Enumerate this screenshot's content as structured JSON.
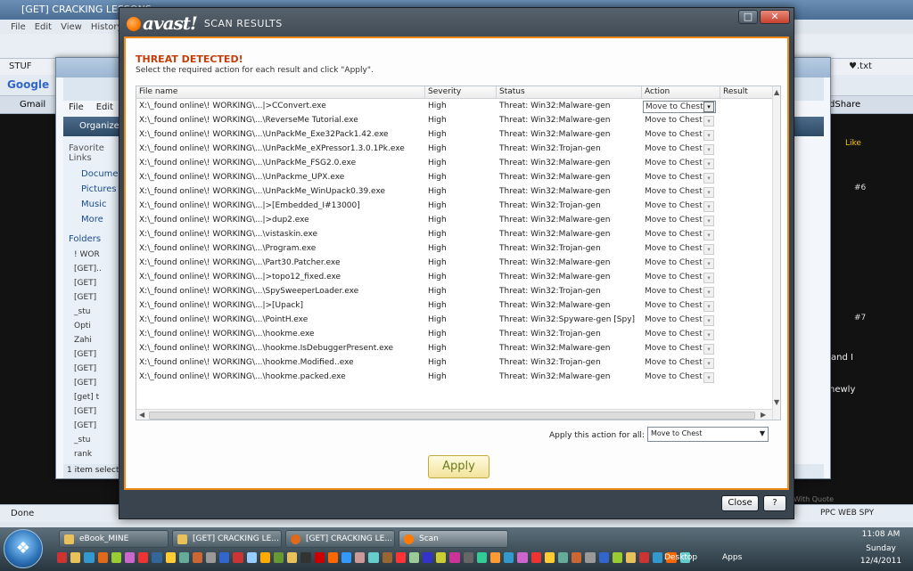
{
  "browser": {
    "title": "[GET] CRACKING LESSONS",
    "menu": [
      "File",
      "Edit",
      "View",
      "History"
    ],
    "bookmark": "STUF",
    "google": "Google",
    "gmail": "Gmail",
    "status": "Done",
    "forum": {
      "like": "Like",
      "post6": "#6",
      "post7": "#7",
      "snippet1": "and I",
      "snippet2": "newly",
      "ppc": "PPC WEB SPY",
      "share": "dShare",
      "txt": "♥.txt",
      "with_quote": "With Quote"
    }
  },
  "explorer": {
    "menu": [
      "File",
      "Edit"
    ],
    "organize": "Organize",
    "favorite_links": "Favorite Links",
    "links": [
      "Documen",
      "Pictures",
      "Music",
      "More"
    ],
    "folders_label": "Folders",
    "folders": [
      "!  WOR",
      "[GET]..",
      "[GET]",
      "[GET]",
      "_stu",
      "Opti",
      "Zahi",
      "[GET]",
      "[GET]",
      "[GET]",
      "[get] t",
      "[GET]",
      "[GET]",
      "_stu",
      "rank",
      "[GET]"
    ],
    "status": "1 item selected"
  },
  "dialog": {
    "brand": "avast!",
    "title": "SCAN RESULTS",
    "heading": "THREAT DETECTED!",
    "subtitle": "Select the required action for each result and click \"Apply\".",
    "columns": {
      "file": "File name",
      "severity": "Severity",
      "status": "Status",
      "action": "Action",
      "result": "Result"
    },
    "rows": [
      {
        "file": "X:\\_found online\\!   WORKING\\...|>CConvert.exe",
        "severity": "High",
        "status": "Threat: Win32:Malware-gen",
        "action": "Move to Chest"
      },
      {
        "file": "X:\\_found online\\!   WORKING\\...\\ReverseMe Tutorial.exe",
        "severity": "High",
        "status": "Threat: Win32:Malware-gen",
        "action": "Move to Chest"
      },
      {
        "file": "X:\\_found online\\!   WORKING\\...\\UnPackMe_Exe32Pack1.42.exe",
        "severity": "High",
        "status": "Threat: Win32:Malware-gen",
        "action": "Move to Chest"
      },
      {
        "file": "X:\\_found online\\!   WORKING\\...\\UnPackMe_eXPressor1.3.0.1Pk.exe",
        "severity": "High",
        "status": "Threat: Win32:Trojan-gen",
        "action": "Move to Chest"
      },
      {
        "file": "X:\\_found online\\!   WORKING\\...\\UnPackMe_FSG2.0.exe",
        "severity": "High",
        "status": "Threat: Win32:Malware-gen",
        "action": "Move to Chest"
      },
      {
        "file": "X:\\_found online\\!   WORKING\\...\\UnPackme_UPX.exe",
        "severity": "High",
        "status": "Threat: Win32:Malware-gen",
        "action": "Move to Chest"
      },
      {
        "file": "X:\\_found online\\!   WORKING\\...\\UnPackMe_WinUpack0.39.exe",
        "severity": "High",
        "status": "Threat: Win32:Malware-gen",
        "action": "Move to Chest"
      },
      {
        "file": "X:\\_found online\\!   WORKING\\...|>[Embedded_I#13000]",
        "severity": "High",
        "status": "Threat: Win32:Trojan-gen",
        "action": "Move to Chest"
      },
      {
        "file": "X:\\_found online\\!   WORKING\\...|>dup2.exe",
        "severity": "High",
        "status": "Threat: Win32:Malware-gen",
        "action": "Move to Chest"
      },
      {
        "file": "X:\\_found online\\!   WORKING\\...\\vistaskin.exe",
        "severity": "High",
        "status": "Threat: Win32:Malware-gen",
        "action": "Move to Chest"
      },
      {
        "file": "X:\\_found online\\!   WORKING\\...\\Program.exe",
        "severity": "High",
        "status": "Threat: Win32:Trojan-gen",
        "action": "Move to Chest"
      },
      {
        "file": "X:\\_found online\\!   WORKING\\...\\Part30.Patcher.exe",
        "severity": "High",
        "status": "Threat: Win32:Malware-gen",
        "action": "Move to Chest"
      },
      {
        "file": "X:\\_found online\\!   WORKING\\...|>topo12_fixed.exe",
        "severity": "High",
        "status": "Threat: Win32:Malware-gen",
        "action": "Move to Chest"
      },
      {
        "file": "X:\\_found online\\!   WORKING\\...\\SpySweeperLoader.exe",
        "severity": "High",
        "status": "Threat: Win32:Trojan-gen",
        "action": "Move to Chest"
      },
      {
        "file": "X:\\_found online\\!   WORKING\\...|>[Upack]",
        "severity": "High",
        "status": "Threat: Win32:Malware-gen",
        "action": "Move to Chest"
      },
      {
        "file": "X:\\_found online\\!   WORKING\\...\\PointH.exe",
        "severity": "High",
        "status": "Threat: Win32:Spyware-gen [Spy]",
        "action": "Move to Chest"
      },
      {
        "file": "X:\\_found online\\!   WORKING\\...\\hookme.exe",
        "severity": "High",
        "status": "Threat: Win32:Trojan-gen",
        "action": "Move to Chest"
      },
      {
        "file": "X:\\_found online\\!   WORKING\\...\\hookme.IsDebuggerPresent.exe",
        "severity": "High",
        "status": "Threat: Win32:Malware-gen",
        "action": "Move to Chest"
      },
      {
        "file": "X:\\_found online\\!   WORKING\\...\\hookme.Modified..exe",
        "severity": "High",
        "status": "Threat: Win32:Trojan-gen",
        "action": "Move to Chest"
      },
      {
        "file": "X:\\_found online\\!   WORKING\\...\\hookme.packed.exe",
        "severity": "High",
        "status": "Threat: Win32:Malware-gen",
        "action": "Move to Chest"
      }
    ],
    "apply_all_label": "Apply this action for all:",
    "apply_all_value": "Move to Chest",
    "apply_button": "Apply",
    "close_button": "Close",
    "help_button": "?"
  },
  "taskbar": {
    "buttons": [
      "eBook_MINE",
      "[GET] CRACKING LE...",
      "[GET] CRACKING LE...",
      "Scan"
    ],
    "desktop": "Desktop",
    "apps": "Apps",
    "time": "11:08 AM",
    "day": "Sunday",
    "date": "12/4/2011"
  },
  "colors": {
    "accent": "#f08a18",
    "heading": "#c33e09",
    "apply_text": "#6b7d1c"
  }
}
